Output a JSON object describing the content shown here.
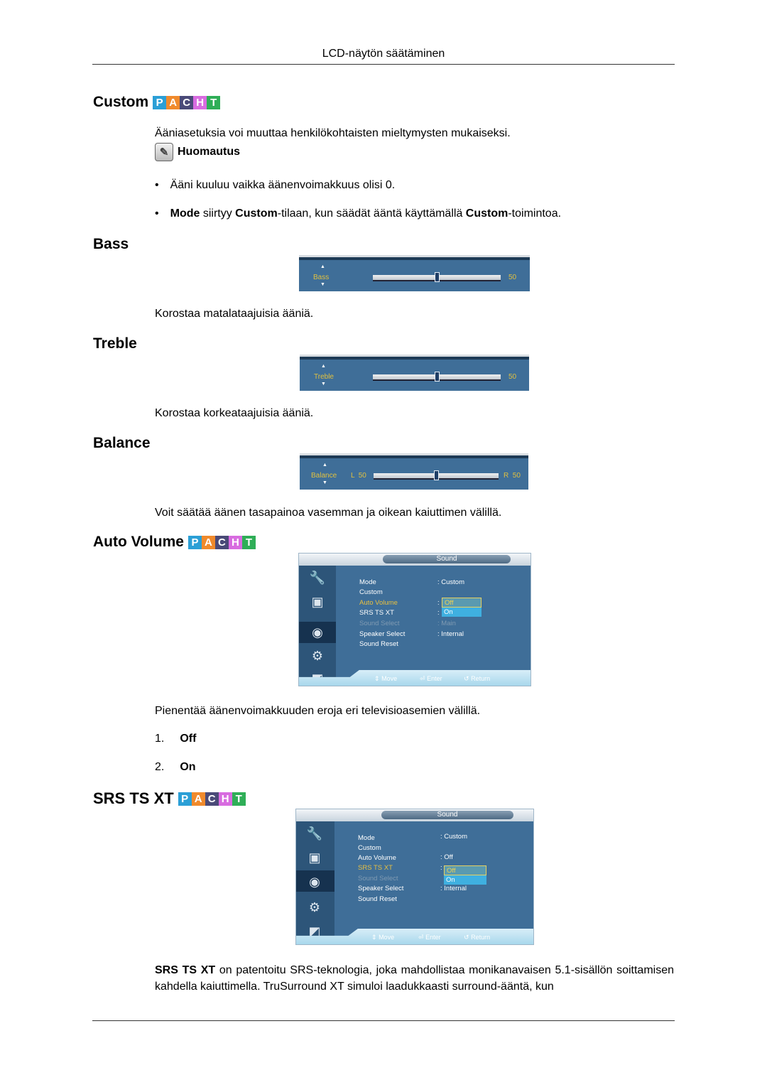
{
  "header": {
    "title": "LCD-näytön säätäminen"
  },
  "pacht_badge": {
    "letters": [
      {
        "char": "P",
        "color": "#2b9fd6"
      },
      {
        "char": "A",
        "color": "#f08a2c"
      },
      {
        "char": "C",
        "color": "#4a4a78"
      },
      {
        "char": "H",
        "color": "#d86ce0"
      },
      {
        "char": "T",
        "color": "#2fae57"
      }
    ]
  },
  "sections": {
    "custom": {
      "title": "Custom",
      "intro": "Ääniasetuksia voi muuttaa henkilökohtaisten mieltymysten mukaiseksi.",
      "note_label": "Huomautus",
      "bullets": {
        "b1": "Ääni kuuluu vaikka äänenvoimakkuus olisi 0.",
        "b2_parts": [
          "Mode",
          " siirtyy ",
          "Custom",
          "-tilaan, kun säädät ääntä käyttämällä ",
          "Custom",
          "-toimintoa."
        ]
      }
    },
    "bass": {
      "title": "Bass",
      "osd_label": "Bass",
      "value": "50",
      "level_percent": 50,
      "description": "Korostaa matalataajuisia ääniä."
    },
    "treble": {
      "title": "Treble",
      "osd_label": "Treble",
      "value": "50",
      "level_percent": 50,
      "description": "Korostaa korkeataajuisia ääniä."
    },
    "balance": {
      "title": "Balance",
      "osd_label": "Balance",
      "left_value": "L  50",
      "right_value": "R  50",
      "level_percent": 50,
      "description": "Voit säätää äänen tasapainoa vasemman ja oikean kaiuttimen välillä."
    },
    "auto_volume": {
      "title": "Auto Volume",
      "description": "Pienentää äänenvoimakkuuden eroja eri televisioasemien välillä.",
      "options": [
        {
          "num": "1.",
          "label": "Off"
        },
        {
          "num": "2.",
          "label": "On"
        }
      ]
    },
    "srs": {
      "title": "SRS TS XT",
      "desc_bold": "SRS TS XT",
      "desc_rest": " on patentoitu SRS-teknologia, joka mahdollistaa monikanavaisen 5.1-sisällön soittamisen kahdella kaiuttimella. TruSurround XT simuloi laadukkaasti surround-ääntä, kun"
    }
  },
  "osd_menus": {
    "auto_volume_menu": {
      "title": "Sound",
      "items": [
        {
          "label": "Mode",
          "value": ": Custom"
        },
        {
          "label": "Custom",
          "value": ""
        },
        {
          "label": "Auto Volume",
          "value": ":"
        },
        {
          "label": "SRS TS XT",
          "value": ":"
        },
        {
          "label": "Sound Select",
          "value": ": Main"
        },
        {
          "label": "Speaker Select",
          "value": ": Internal"
        },
        {
          "label": "Sound Reset",
          "value": ""
        }
      ],
      "dropdown": [
        "Off",
        "On"
      ],
      "footer": {
        "move": "Move",
        "enter": "Enter",
        "return": "Return"
      }
    },
    "srs_menu": {
      "title": "Sound",
      "items": [
        {
          "label": "Mode",
          "value": ": Custom"
        },
        {
          "label": "Custom",
          "value": ""
        },
        {
          "label": "Auto Volume",
          "value": ": Off"
        },
        {
          "label": "SRS TS XT",
          "value": ":"
        },
        {
          "label": "Sound Select",
          "value": ""
        },
        {
          "label": "Speaker Select",
          "value": ": Internal"
        },
        {
          "label": "Sound Reset",
          "value": ""
        }
      ],
      "dropdown": [
        "Off",
        "On"
      ],
      "footer": {
        "move": "Move",
        "enter": "Enter",
        "return": "Return"
      }
    }
  },
  "icons": {
    "note": "✎",
    "up": "▲",
    "down": "▼",
    "move": "⇕",
    "enter": "⏎",
    "return": "↺"
  }
}
